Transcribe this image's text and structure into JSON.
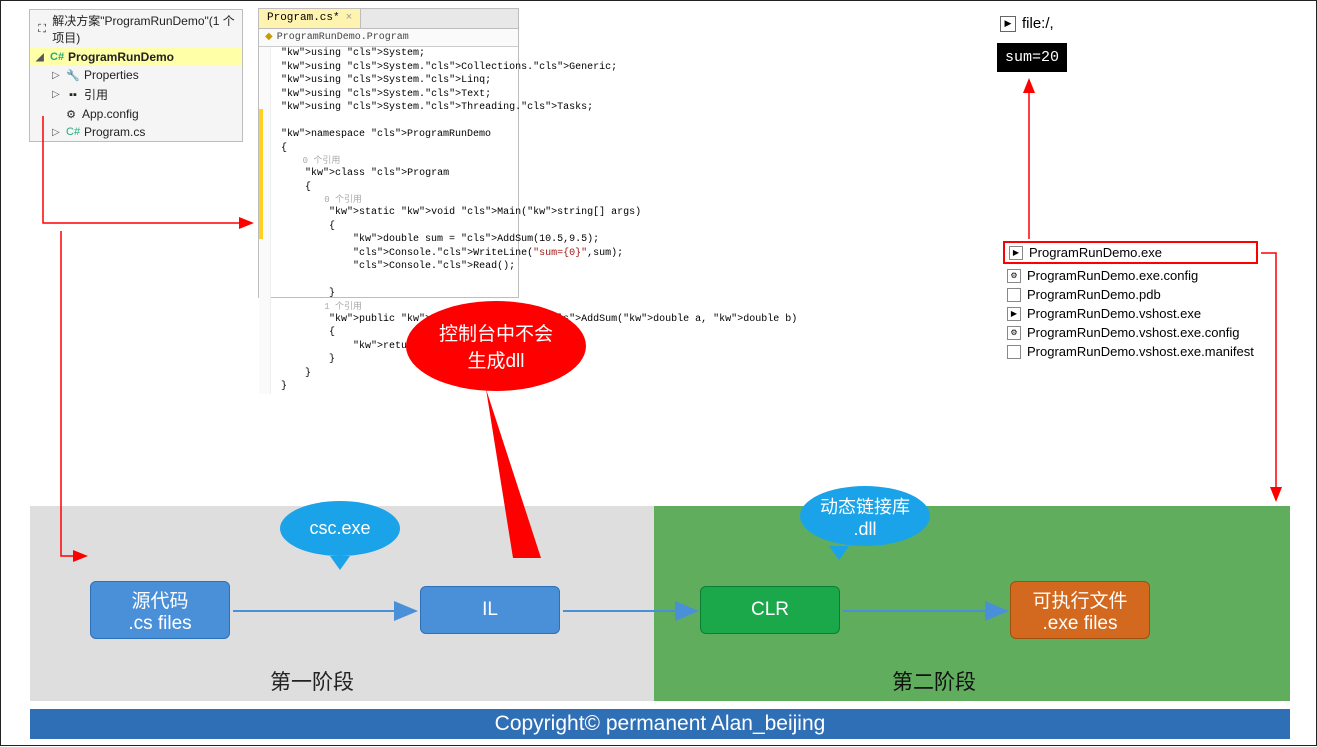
{
  "solution": {
    "title_prefix": "解决方案\"ProgramRunDemo\"(1 个项目)",
    "project": "ProgramRunDemo",
    "items": [
      "Properties",
      "引用",
      "App.config",
      "Program.cs"
    ]
  },
  "editor": {
    "tab": "Program.cs*",
    "crumb": "ProgramRunDemo.Program",
    "code_lines": [
      {
        "t": "using System;",
        "c": "kw-cls"
      },
      {
        "t": "using System.Collections.Generic;",
        "c": ""
      },
      {
        "t": "using System.Linq;",
        "c": ""
      },
      {
        "t": "using System.Text;",
        "c": ""
      },
      {
        "t": "using System.Threading.Tasks;",
        "c": ""
      },
      {
        "t": "",
        "c": ""
      },
      {
        "t": "namespace ProgramRunDemo",
        "c": ""
      },
      {
        "t": "{",
        "c": ""
      },
      {
        "t": "    0 个引用",
        "c": "ref"
      },
      {
        "t": "    class Program",
        "c": ""
      },
      {
        "t": "    {",
        "c": ""
      },
      {
        "t": "        0 个引用",
        "c": "ref"
      },
      {
        "t": "        static void Main(string[] args)",
        "c": ""
      },
      {
        "t": "        {",
        "c": ""
      },
      {
        "t": "            double sum = AddSum(10.5,9.5);",
        "c": ""
      },
      {
        "t": "            Console.WriteLine(\"sum={0}\",sum);",
        "c": ""
      },
      {
        "t": "            Console.Read();",
        "c": ""
      },
      {
        "t": "",
        "c": ""
      },
      {
        "t": "        }",
        "c": ""
      },
      {
        "t": "        1 个引用",
        "c": "ref"
      },
      {
        "t": "        public static double AddSum(double a, double b)",
        "c": ""
      },
      {
        "t": "        {",
        "c": ""
      },
      {
        "t": "            return a + b;",
        "c": ""
      },
      {
        "t": "        }",
        "c": ""
      },
      {
        "t": "    }",
        "c": ""
      },
      {
        "t": "}",
        "c": ""
      }
    ]
  },
  "console": {
    "title": "file:/,",
    "output": "sum=20"
  },
  "files": [
    "ProgramRunDemo.exe",
    "ProgramRunDemo.exe.config",
    "ProgramRunDemo.pdb",
    "ProgramRunDemo.vshost.exe",
    "ProgramRunDemo.vshost.exe.config",
    "ProgramRunDemo.vshost.exe.manifest"
  ],
  "diagram": {
    "src_l1": "源代码",
    "src_l2": ".cs files",
    "il": "IL",
    "clr": "CLR",
    "exe_l1": "可执行文件",
    "exe_l2": ".exe files",
    "csc": "csc.exe",
    "dll_l1": "动态链接库",
    "dll_l2": ".dll",
    "stage1": "第一阶段",
    "stage2": "第二阶段",
    "red_l1": "控制台中不会",
    "red_l2": "生成dll"
  },
  "copyright": "Copyright© permanent  Alan_beijing"
}
